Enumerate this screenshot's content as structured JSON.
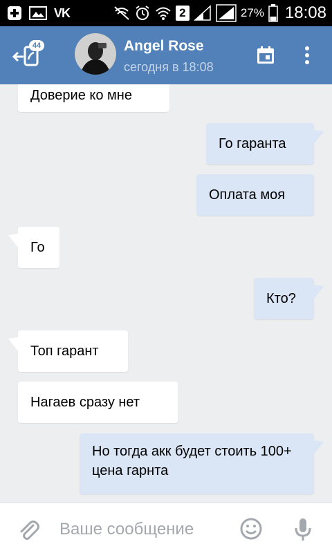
{
  "status_bar": {
    "vk_logo": "VK",
    "sim_slot": "2",
    "battery": "27%",
    "time": "18:08",
    "icons": [
      "plus-square-icon",
      "image-icon",
      "vk-icon",
      "no-signal-icon",
      "alarm-icon",
      "wifi-icon",
      "sim-2-icon",
      "signal-icon",
      "battery-icon"
    ]
  },
  "header": {
    "unread_count": "44",
    "contact_name": "Angel Rose",
    "contact_status": "сегодня в 18:08",
    "colors": {
      "header_bg": "#5181b8",
      "status_text": "#c3d4e8"
    }
  },
  "messages": [
    {
      "direction": "in",
      "text": "Доверие ко мне"
    },
    {
      "direction": "out",
      "text": "Го гаранта"
    },
    {
      "direction": "out",
      "text": "Оплата моя"
    },
    {
      "direction": "in",
      "text": "Го"
    },
    {
      "direction": "out",
      "text": "Кто?"
    },
    {
      "direction": "in",
      "text": "Топ гарант"
    },
    {
      "direction": "in",
      "text": "Нагаев сразу нет"
    },
    {
      "direction": "out",
      "text": "Но тогда акк будет стоить 100+ цена гарнта"
    }
  ],
  "composer": {
    "placeholder": "Ваше сообщение",
    "value": ""
  },
  "colors": {
    "chat_bg": "#edeef0",
    "incoming_bubble": "#ffffff",
    "outgoing_bubble": "#dae6f5",
    "icon_gray": "#a3a8ae"
  }
}
